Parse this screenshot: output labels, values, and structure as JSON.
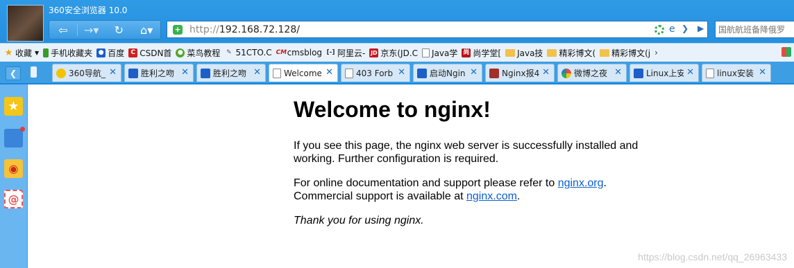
{
  "window": {
    "title": "360安全浏览器 10.0"
  },
  "address_bar": {
    "protocol": "http://",
    "host": "192.168.72.128/",
    "engine_glyph": "e"
  },
  "search": {
    "placeholder": "国航航班备降俄罗"
  },
  "bookmarks": {
    "favorites_label": "收藏",
    "items": [
      {
        "label": "手机收藏夹",
        "icon": "phone-icon"
      },
      {
        "label": "百度",
        "icon": "baidu-icon"
      },
      {
        "label": "CSDN首",
        "icon": "csdn-icon"
      },
      {
        "label": "菜鸟教程",
        "icon": "runoob-icon"
      },
      {
        "label": "51CTO.C",
        "icon": "51cto-icon"
      },
      {
        "label": "cmsblog",
        "icon": "cmsblog-icon"
      },
      {
        "label": "阿里云-",
        "icon": "aliyun-icon"
      },
      {
        "label": "京东(JD.C",
        "icon": "jd-icon"
      },
      {
        "label": "Java学",
        "icon": "page-icon"
      },
      {
        "label": "尚学堂[",
        "icon": "shangxuetang-icon"
      },
      {
        "label": "Java技",
        "icon": "folder-icon"
      },
      {
        "label": "精彩博文(",
        "icon": "folder-icon"
      },
      {
        "label": "精彩博文(j",
        "icon": "folder-icon"
      }
    ],
    "more": "›"
  },
  "tabs": [
    {
      "label": "360导航_",
      "icon": "nav360",
      "active": false
    },
    {
      "label": "胜利之吻",
      "icon": "paw",
      "active": false
    },
    {
      "label": "胜利之吻",
      "icon": "paw",
      "active": false
    },
    {
      "label": "Welcome",
      "icon": "doc",
      "active": true
    },
    {
      "label": "403 Forb",
      "icon": "doc",
      "active": false
    },
    {
      "label": "启动Ngin",
      "icon": "paw",
      "active": false
    },
    {
      "label": "Nginx报4",
      "icon": "nginx",
      "active": false
    },
    {
      "label": "微博之夜",
      "icon": "weibo",
      "active": false
    },
    {
      "label": "Linux上安",
      "icon": "paw",
      "active": false
    },
    {
      "label": "linux安装",
      "icon": "doc",
      "active": false
    }
  ],
  "page": {
    "heading": "Welcome to nginx!",
    "para1": "If you see this page, the nginx web server is successfully installed and working. Further configuration is required.",
    "para2_prefix": "For online documentation and support please refer to ",
    "link1": "nginx.org",
    "para2_mid": ".",
    "para3_prefix": "Commercial support is available at ",
    "link2": "nginx.com",
    "para3_suffix": ".",
    "thanks": "Thank you for using nginx."
  },
  "watermark": "https://blog.csdn.net/qq_26963433"
}
